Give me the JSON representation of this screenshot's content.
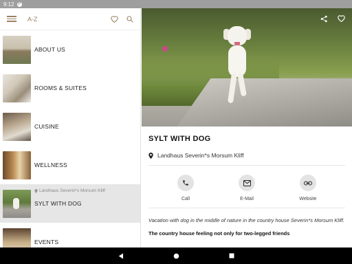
{
  "status": {
    "time": "9:12",
    "notif_glyph": "P"
  },
  "left": {
    "az_label": "A-Z",
    "items": [
      {
        "label": "ABOUT US"
      },
      {
        "label": "ROOMS & SUITES"
      },
      {
        "label": "CUISINE"
      },
      {
        "label": "WELLNESS"
      },
      {
        "label": "SYLT WITH DOG",
        "sub": "Landhaus Severin*s Morsum Kliff",
        "active": true
      },
      {
        "label": "EVENTS"
      }
    ]
  },
  "detail": {
    "title": "SYLT WITH DOG",
    "location": "Landhaus Severin*s Morsum Kliff",
    "actions": [
      {
        "label": "Call",
        "icon": "phone-icon"
      },
      {
        "label": "E-Mail",
        "icon": "mail-icon"
      },
      {
        "label": "Website",
        "icon": "link-icon"
      }
    ],
    "description": "Vacation with dog in the middle of nature in the country house Severin*s Morsum Kliff.",
    "subheading": "The country house feeling not only for two-legged friends"
  },
  "colors": {
    "accent": "#9b8160",
    "status_bar": "#9e9e9e",
    "nav_bar": "#000000"
  }
}
